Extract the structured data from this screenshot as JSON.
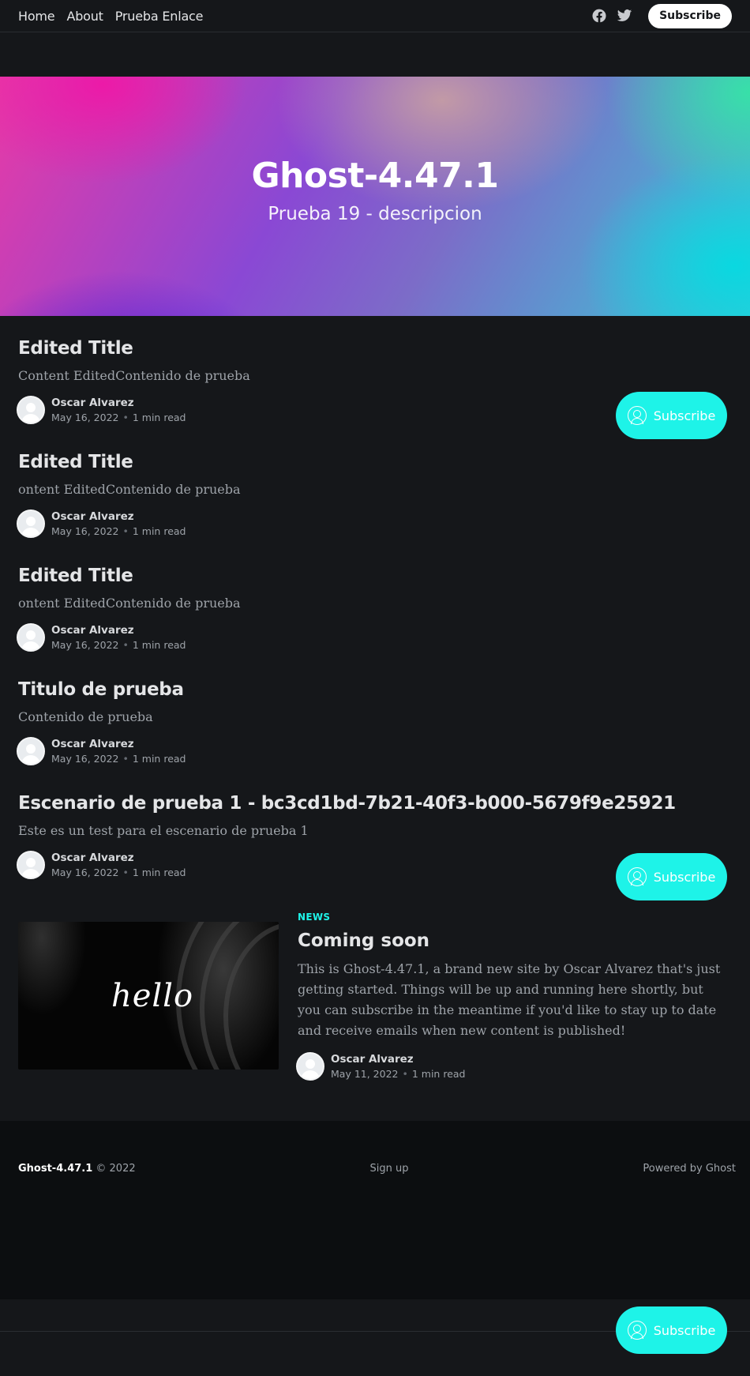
{
  "nav": {
    "items": [
      {
        "label": "Home"
      },
      {
        "label": "About"
      },
      {
        "label": "Prueba Enlace"
      }
    ],
    "social": [
      "facebook-icon",
      "twitter-icon"
    ],
    "subscribe_label": "Subscribe"
  },
  "hero": {
    "title": "Ghost-4.47.1",
    "description": "Prueba 19 - descripcion"
  },
  "posts": [
    {
      "title": "Edited Title",
      "excerpt": "Content EditedContenido de prueba",
      "author": "Oscar Alvarez",
      "date": "May 16, 2022",
      "read": "1 min read"
    },
    {
      "title": "Edited Title",
      "excerpt": "ontent EditedContenido de prueba",
      "author": "Oscar Alvarez",
      "date": "May 16, 2022",
      "read": "1 min read"
    },
    {
      "title": "Edited Title",
      "excerpt": "ontent EditedContenido de prueba",
      "author": "Oscar Alvarez",
      "date": "May 16, 2022",
      "read": "1 min read"
    },
    {
      "title": "Titulo de prueba",
      "excerpt": "Contenido de prueba",
      "author": "Oscar Alvarez",
      "date": "May 16, 2022",
      "read": "1 min read"
    },
    {
      "title": "Escenario de prueba 1 - bc3cd1bd-7b21-40f3-b000-5679f9e25921",
      "excerpt": "Este es un test para el escenario de prueba 1",
      "author": "Oscar Alvarez",
      "date": "May 16, 2022",
      "read": "1 min read"
    }
  ],
  "featured": {
    "tag": "NEWS",
    "image_text": "hello",
    "title": "Coming soon",
    "excerpt": "This is Ghost-4.47.1, a brand new site by Oscar Alvarez that's just getting started. Things will be up and running here shortly, but you can subscribe in the meantime if you'd like to stay up to date and receive emails when new content is published!",
    "author": "Oscar Alvarez",
    "date": "May 11, 2022",
    "read": "1 min read"
  },
  "floating_subscribe": {
    "label": "Subscribe"
  },
  "footer": {
    "brand": "Ghost-4.47.1",
    "copyright": "© 2022",
    "signup": "Sign up",
    "powered": "Powered by Ghost"
  },
  "colors": {
    "accent": "#1ef3e8",
    "background": "#15171a",
    "footer_bg": "#0c0e10"
  }
}
